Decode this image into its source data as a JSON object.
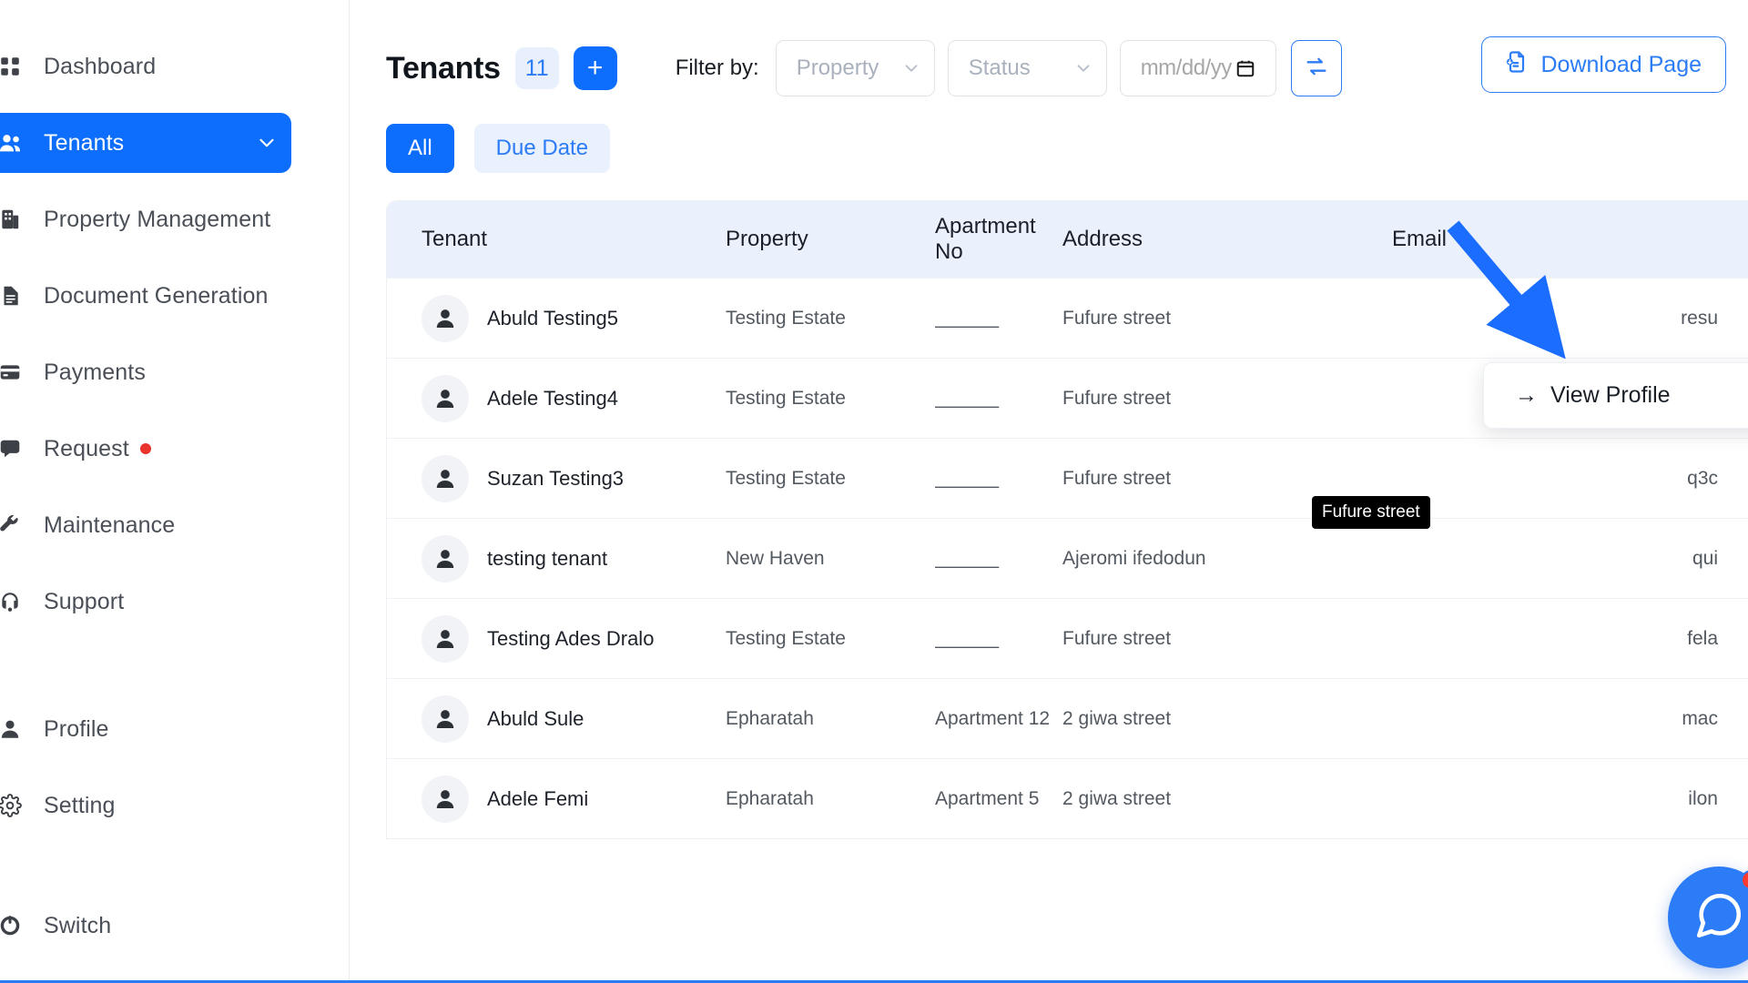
{
  "sidebar": {
    "items": [
      {
        "label": "Dashboard",
        "icon": "grid-icon",
        "active": false,
        "badge": false,
        "chevron": false
      },
      {
        "label": "Tenants",
        "icon": "users-icon",
        "active": true,
        "badge": false,
        "chevron": true
      },
      {
        "label": "Property Management",
        "icon": "building-icon",
        "active": false,
        "badge": false,
        "chevron": false
      },
      {
        "label": "Document Generation",
        "icon": "document-icon",
        "active": false,
        "badge": false,
        "chevron": false
      },
      {
        "label": "Payments",
        "icon": "credit-card-icon",
        "active": false,
        "badge": false,
        "chevron": false
      },
      {
        "label": "Request",
        "icon": "inbox-icon",
        "active": false,
        "badge": true,
        "chevron": false
      },
      {
        "label": "Maintenance",
        "icon": "wrench-icon",
        "active": false,
        "badge": false,
        "chevron": false
      },
      {
        "label": "Support",
        "icon": "headset-icon",
        "active": false,
        "badge": false,
        "chevron": false
      },
      {
        "label": "Profile",
        "icon": "user-icon",
        "active": false,
        "badge": false,
        "chevron": false
      },
      {
        "label": "Setting",
        "icon": "gear-icon",
        "active": false,
        "badge": false,
        "chevron": false
      },
      {
        "label": "Switch",
        "icon": "switch-icon",
        "active": false,
        "badge": false,
        "chevron": false
      }
    ],
    "badge_color": "#e8342a",
    "active_color": "#0d6efd"
  },
  "header": {
    "title": "Tenants",
    "count": "11",
    "add_label": "+",
    "filter_label": "Filter by:",
    "property_filter": {
      "value": "Property",
      "options": [
        "Property"
      ]
    },
    "status_filter": {
      "value": "Status",
      "options": [
        "Status"
      ]
    },
    "date_filter": {
      "placeholder": "mm/dd/yy",
      "value": ""
    },
    "refresh_icon": "refresh-icon",
    "download_label": "Download Page",
    "download_icon": "file-download-icon",
    "accent_color": "#0d6efd"
  },
  "tabs": [
    {
      "label": "All",
      "active": true
    },
    {
      "label": "Due Date",
      "active": false
    }
  ],
  "table": {
    "columns": [
      "Tenant",
      "Property",
      "Apartment No",
      "Address",
      "Email"
    ],
    "rows": [
      {
        "tenant": "Abuld Testing5",
        "property": "Testing Estate",
        "apartment": "______",
        "address": "Fufure street",
        "email": "resu"
      },
      {
        "tenant": "Adele Testing4",
        "property": "Testing Estate",
        "apartment": "______",
        "address": "Fufure street",
        "email": ""
      },
      {
        "tenant": "Suzan Testing3",
        "property": "Testing Estate",
        "apartment": "______",
        "address": "Fufure street",
        "email": "q3c"
      },
      {
        "tenant": "testing tenant",
        "property": "New Haven",
        "apartment": "______",
        "address": "Ajeromi ifedodun",
        "email": "qui"
      },
      {
        "tenant": "Testing Ades Dralo",
        "property": "Testing Estate",
        "apartment": "______",
        "address": "Fufure street",
        "email": "fela"
      },
      {
        "tenant": "Abuld Sule",
        "property": "Epharatah",
        "apartment": "Apartment 12",
        "address": "2 giwa street",
        "email": "mac"
      },
      {
        "tenant": "Adele Femi",
        "property": "Epharatah",
        "apartment": "Apartment 5",
        "address": "2 giwa street",
        "email": "ilon"
      }
    ],
    "row_menu_icon": "kebab-menu-icon",
    "avatar_icon": "person-avatar-icon"
  },
  "popup_menu": {
    "arrow": "→",
    "label": "View Profile"
  },
  "tooltip": {
    "text": "Fufure street"
  },
  "annotation": {
    "type": "arrow-pointer",
    "color": "#1a6dff"
  },
  "chat_widget": {
    "icon": "chat-icon",
    "badge": true,
    "color": "#2b7cf6",
    "badge_color": "#ff3b2f"
  }
}
